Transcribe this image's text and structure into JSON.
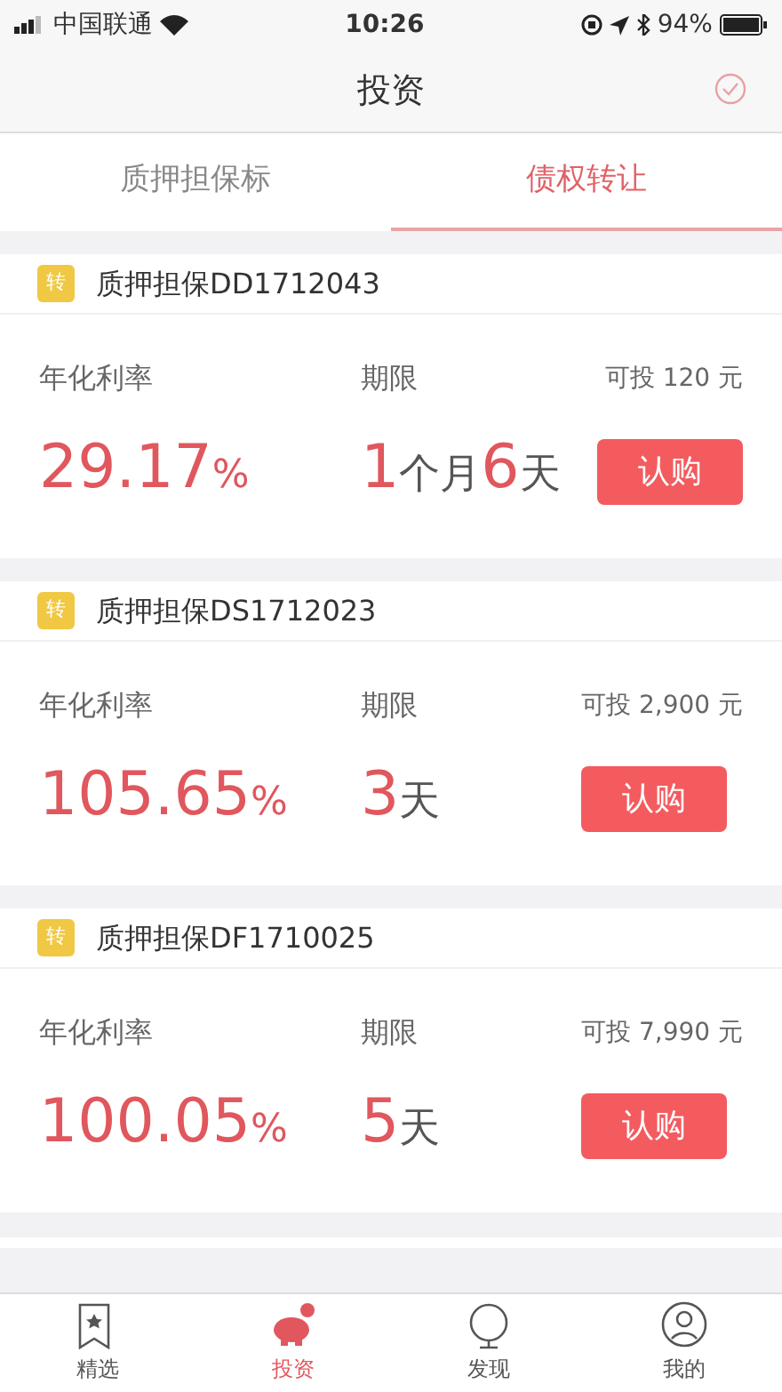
{
  "status_bar": {
    "carrier": "中国联通",
    "time": "10:26",
    "battery": "94%"
  },
  "nav": {
    "title": "投资"
  },
  "tabs": [
    {
      "label": "质押担保标",
      "selected": false
    },
    {
      "label": "债权转让",
      "selected": true
    }
  ],
  "products": [
    {
      "badge": "转",
      "name": "质押担保DD1712043",
      "rate_label": "年化利率",
      "rate": {
        "number": "29.17",
        "unit": "%"
      },
      "term_label": "期限",
      "term": [
        {
          "kind": "number",
          "text": "1"
        },
        {
          "kind": "unit",
          "text": "个月"
        },
        {
          "kind": "number",
          "text": "6"
        },
        {
          "kind": "unit",
          "text": "天"
        }
      ],
      "available": "可投 120 元",
      "button": "认购"
    },
    {
      "badge": "转",
      "name": "质押担保DS1712023",
      "rate_label": "年化利率",
      "rate": {
        "number": "105.65",
        "unit": "%"
      },
      "term_label": "期限",
      "term": [
        {
          "kind": "number",
          "text": "3"
        },
        {
          "kind": "unit",
          "text": "天"
        }
      ],
      "available": "可投 2,900 元",
      "button": "认购"
    },
    {
      "badge": "转",
      "name": "质押担保DF1710025",
      "rate_label": "年化利率",
      "rate": {
        "number": "100.05",
        "unit": "%"
      },
      "term_label": "期限",
      "term": [
        {
          "kind": "number",
          "text": "5"
        },
        {
          "kind": "unit",
          "text": "天"
        }
      ],
      "available": "可投 7,990 元",
      "button": "认购"
    }
  ],
  "tab_bar": [
    {
      "kind": "bookmark",
      "label": "精选",
      "selected": false
    },
    {
      "kind": "piggy",
      "label": "投资",
      "selected": true
    },
    {
      "kind": "globe",
      "label": "发现",
      "selected": false
    },
    {
      "kind": "user",
      "label": "我的",
      "selected": false
    }
  ]
}
